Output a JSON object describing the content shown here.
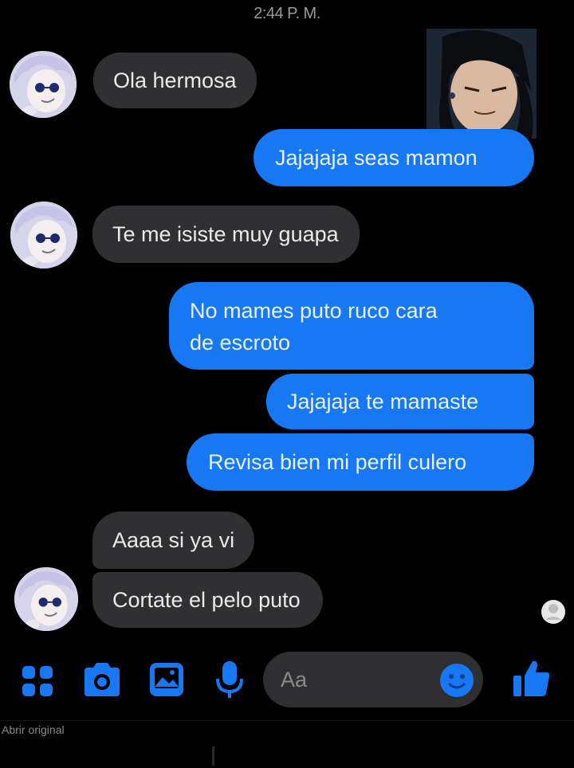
{
  "status": {
    "time": "2:44 P. M."
  },
  "messages": [
    {
      "text": "Ola hermosa",
      "direction": "incoming"
    },
    {
      "text": "Jajajaja seas mamon",
      "direction": "outgoing"
    },
    {
      "text": "Te me isiste muy guapa",
      "direction": "incoming"
    },
    {
      "text_line1": "No mames puto ruco cara",
      "text_line2": "de escroto",
      "direction": "outgoing"
    },
    {
      "text": "Jajajaja te mamaste",
      "direction": "outgoing"
    },
    {
      "text": "Revisa bien mi perfil culero",
      "direction": "outgoing"
    },
    {
      "text": "Aaaa si ya vi",
      "direction": "incoming"
    },
    {
      "text": "Cortate el pelo puto",
      "direction": "incoming"
    }
  ],
  "composer": {
    "placeholder": "Aa",
    "icons": [
      "apps-grid-icon",
      "camera-icon",
      "gallery-icon",
      "microphone-icon",
      "emoji-icon",
      "thumbs-up-icon"
    ]
  },
  "footer": {
    "note": "Abrir original"
  },
  "colors": {
    "background": "#000000",
    "incoming_bubble": "#303033",
    "outgoing_bubble": "#1877f2",
    "accent": "#1877f2"
  }
}
